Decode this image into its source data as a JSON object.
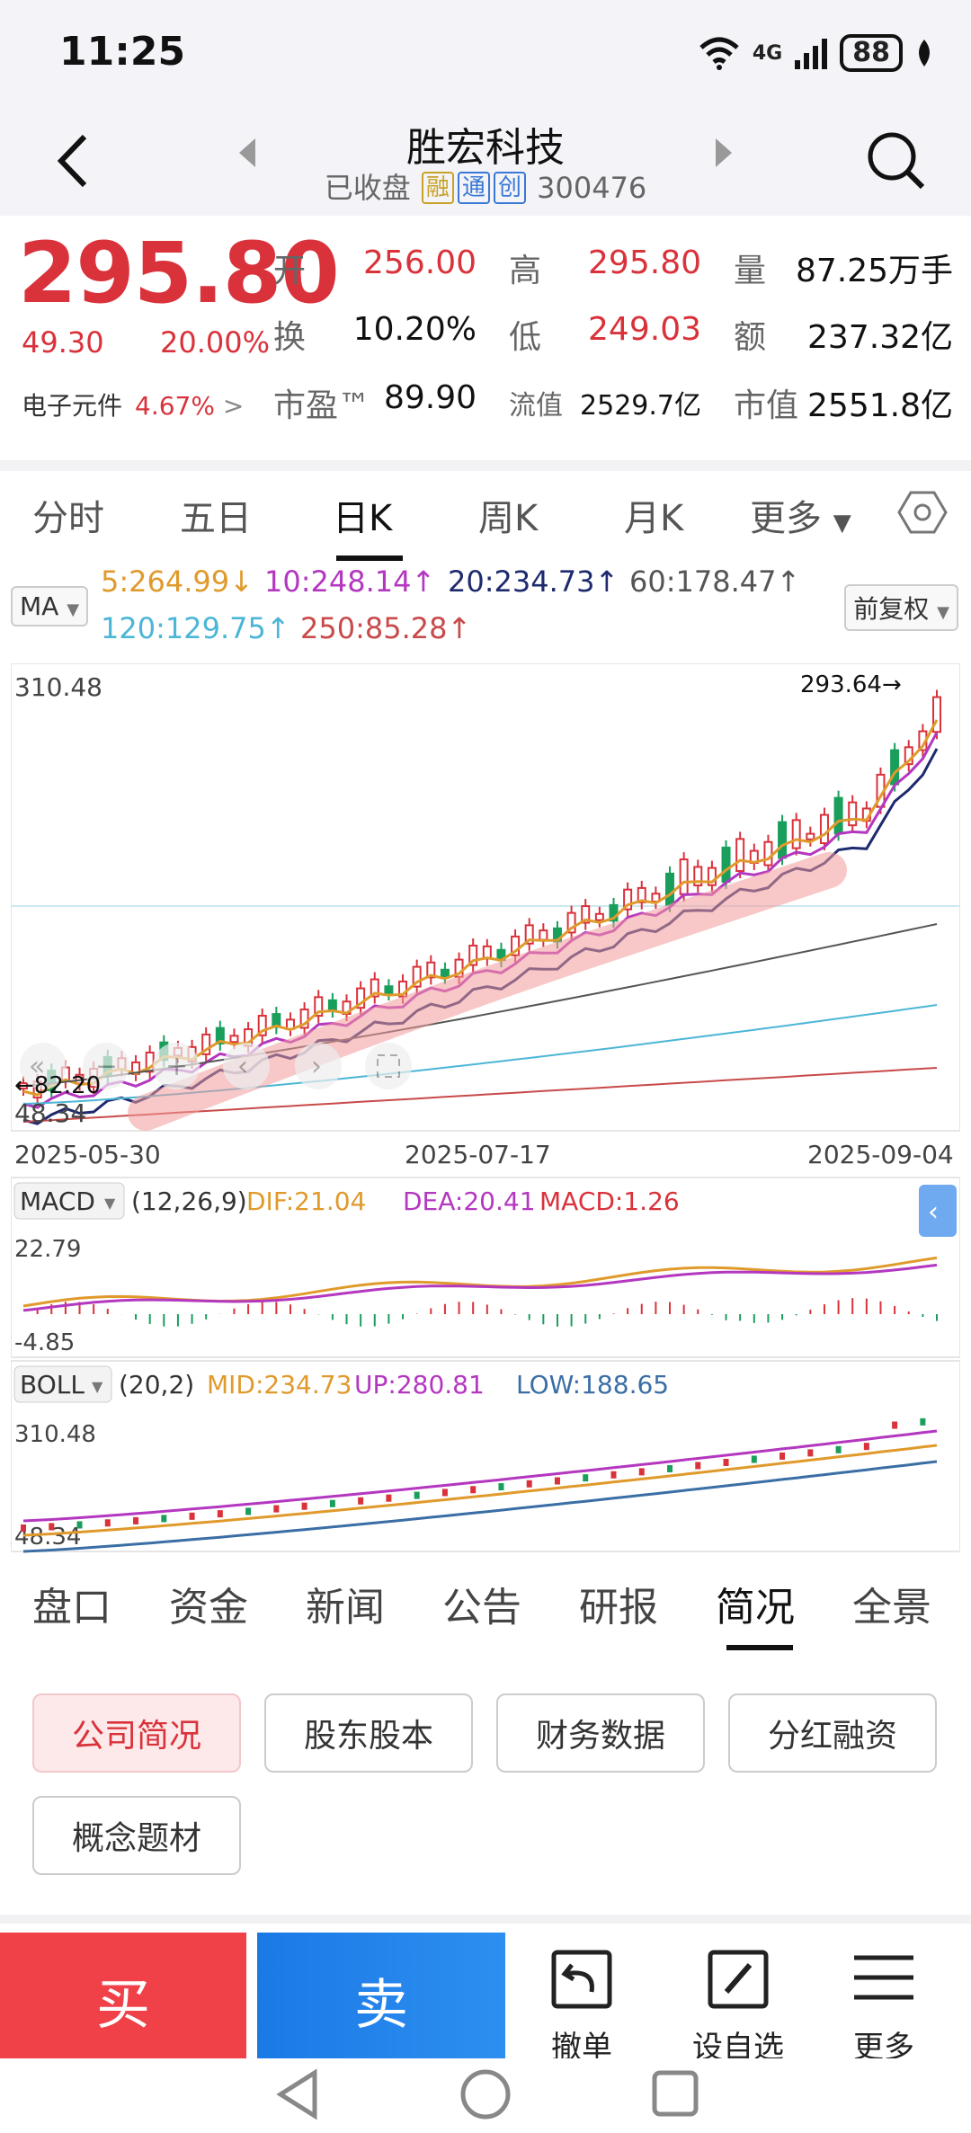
{
  "status": {
    "time": "11:25",
    "network": "4G",
    "battery": "88"
  },
  "header": {
    "title": "胜宏科技",
    "status_text": "已收盘",
    "tags": [
      "融",
      "通",
      "创"
    ],
    "code": "300476"
  },
  "quote": {
    "price": "295.80",
    "change": "49.30",
    "change_pct": "20.00%",
    "sector": "电子元件",
    "sector_pct": "4.67%",
    "open_label": "开",
    "open": "256.00",
    "high_label": "高",
    "high": "295.80",
    "vol_label": "量",
    "vol": "87.25万手",
    "turnover_label": "换",
    "turnover": "10.20%",
    "low_label": "低",
    "low": "249.03",
    "amount_label": "额",
    "amount": "237.32亿",
    "pe_label": "市盈™",
    "pe": "89.90",
    "float_label": "流值",
    "float": "2529.7亿",
    "mcap_label": "市值",
    "mcap": "2551.8亿"
  },
  "chart_tabs": [
    "分时",
    "五日",
    "日K",
    "周K",
    "月K",
    "更多"
  ],
  "ma": {
    "label": "MA",
    "ma5": "5:264.99↓",
    "ma10": "10:248.14↑",
    "ma20": "20:234.73↑",
    "ma60": "60:178.47↑",
    "ma120": "120:129.75↑",
    "ma250": "250:85.28↑",
    "adjust": "前复权"
  },
  "kline": {
    "y_max_label": "310.48",
    "y_min_label": "48.34",
    "high_marker": "293.64→",
    "low_marker": "←82.20",
    "dates": [
      "2025-05-30",
      "2025-07-17",
      "2025-09-04"
    ]
  },
  "macd": {
    "label": "MACD",
    "params": "(12,26,9)",
    "dif": "DIF:21.04",
    "dea": "DEA:20.41",
    "macd": "MACD:1.26",
    "y_max": "22.79",
    "y_min": "-4.85"
  },
  "boll": {
    "label": "BOLL",
    "params": "(20,2)",
    "mid": "MID:234.73",
    "up": "UP:280.81",
    "low": "LOW:188.65",
    "y_max": "310.48",
    "y_min": "48.34"
  },
  "bottom_tabs": [
    "盘口",
    "资金",
    "新闻",
    "公告",
    "研报",
    "简况",
    "全景"
  ],
  "company_buttons": [
    "公司简况",
    "股东股本",
    "财务数据",
    "分红融资",
    "概念题材"
  ],
  "actions": {
    "buy": "买",
    "sell": "卖",
    "cancel": "撤单",
    "watch": "设自选",
    "more": "更多"
  },
  "colors": {
    "up": "#d9323b",
    "down": "#1a9e5c",
    "ma5": "#e09a2c",
    "ma10": "#b437c0",
    "ma20": "#1e2a6e",
    "ma60": "#555555",
    "ma120": "#4cb6d6",
    "ma250": "#c84a4a"
  }
}
